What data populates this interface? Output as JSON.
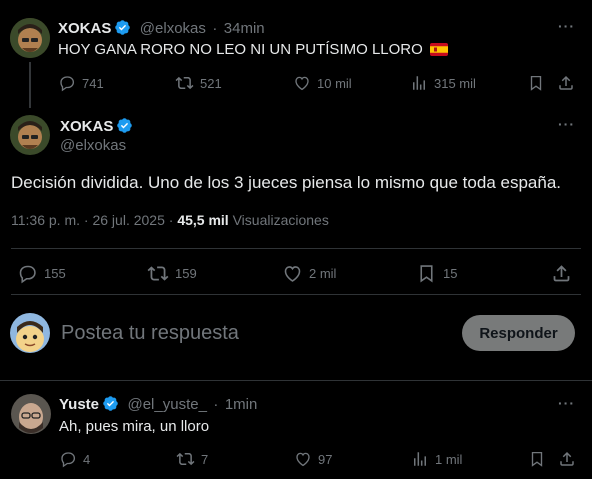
{
  "tweet1": {
    "name": "XOKAS",
    "handle": "@elxokas",
    "sep": "·",
    "time": "34min",
    "text": "HOY GANA RORO NO LEO NI UN PUTÍSIMO LLORO",
    "replies": "741",
    "retweets": "521",
    "likes": "10 mil",
    "views": "315 mil"
  },
  "main": {
    "name": "XOKAS",
    "handle": "@elxokas",
    "text": "Decisión dividida. Uno de los 3 jueces piensa lo mismo que toda españa.",
    "time": "11:36 p. m.",
    "dot": "·",
    "date": "26 jul. 2025",
    "dot2": "·",
    "views_count": "45,5 mil",
    "views_label": "Visualizaciones",
    "replies": "155",
    "retweets": "159",
    "likes": "2 mil",
    "bookmarks": "15"
  },
  "composer": {
    "placeholder": "Postea tu respuesta",
    "button": "Responder"
  },
  "reply": {
    "name": "Yuste",
    "handle": "@el_yuste_",
    "sep": "·",
    "time": "1min",
    "text": "Ah, pues mira, un lloro",
    "replies": "4",
    "retweets": "7",
    "likes": "97",
    "views": "1 mil"
  },
  "colors": {
    "background": "#000000",
    "text": "#e7e9ea",
    "muted": "#71767b",
    "verified": "#1d9bf0",
    "button": "#787a7a"
  }
}
